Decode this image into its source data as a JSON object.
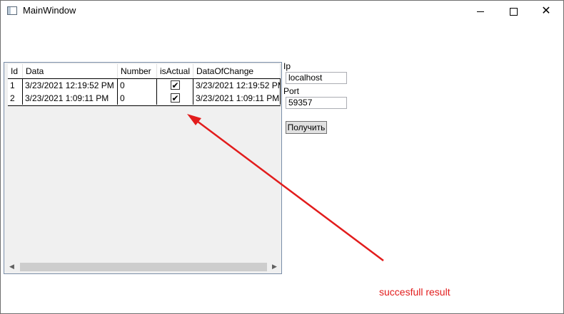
{
  "window": {
    "title": "MainWindow"
  },
  "grid": {
    "columns": [
      "Id",
      "Data",
      "Number",
      "isActual",
      "DataOfChange"
    ],
    "rows": [
      {
        "id": "1",
        "data": "3/23/2021 12:19:52 PM",
        "number": "0",
        "is_actual": true,
        "data_of_change": "3/23/2021 12:19:52 PM"
      },
      {
        "id": "2",
        "data": "3/23/2021 1:09:11 PM",
        "number": "0",
        "is_actual": true,
        "data_of_change": "3/23/2021 1:09:11 PM"
      }
    ]
  },
  "form": {
    "ip_label": "Ip",
    "ip_value": "localhost",
    "port_label": "Port",
    "port_value": "59357",
    "submit_label": "Получить"
  },
  "annotation": {
    "text": "succesfull result",
    "color": "#e21c1c"
  },
  "icons": {
    "minimize": "minimize-icon",
    "maximize": "maximize-icon",
    "close": "close-icon"
  }
}
